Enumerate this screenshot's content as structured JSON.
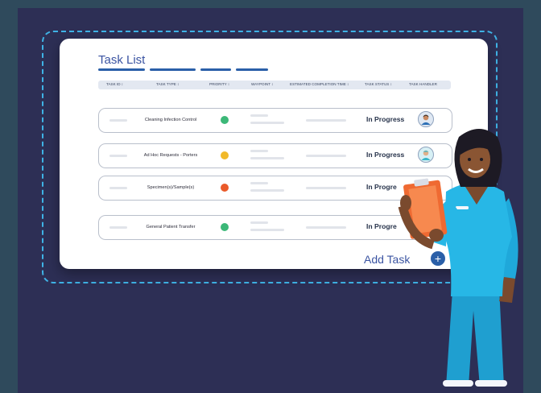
{
  "card": {
    "title": "Task List",
    "add_task_label": "Add Task",
    "add_icon": "+"
  },
  "columns": [
    "TASK ID ↕",
    "TASK TYPE ↕",
    "PRIORITY ↕",
    "WAYPOINT ↕",
    "ESTIMATED COMPLETION TIME ↕",
    "TASK STATUS ↕",
    "TASK HANDLER"
  ],
  "rows": [
    {
      "task_type": "Cleaning Infection Control",
      "priority_color": "#3cb878",
      "status": "In Progress",
      "handler_icon": "doctor-avatar-icon"
    },
    {
      "task_type": "Ad Hoc Requests - Porters",
      "priority_color": "#f1b92a",
      "status": "In Progress",
      "handler_icon": "nurse-avatar-icon"
    },
    {
      "task_type": "Specimen(s)/Sample(s)",
      "priority_color": "#ea5a2a",
      "status": "In Progre",
      "handler_icon": "handler-avatar-icon"
    },
    {
      "task_type": "General Patient Transfer",
      "priority_color": "#3cb878",
      "status": "In Progre",
      "handler_icon": "handler-avatar-icon"
    }
  ],
  "colors": {
    "background": "#2d2f55",
    "accent": "#3b54a2",
    "dashed_outline": "#3fb3e6",
    "scrubs": "#27b7e6",
    "clipboard": "#ef6a32"
  }
}
